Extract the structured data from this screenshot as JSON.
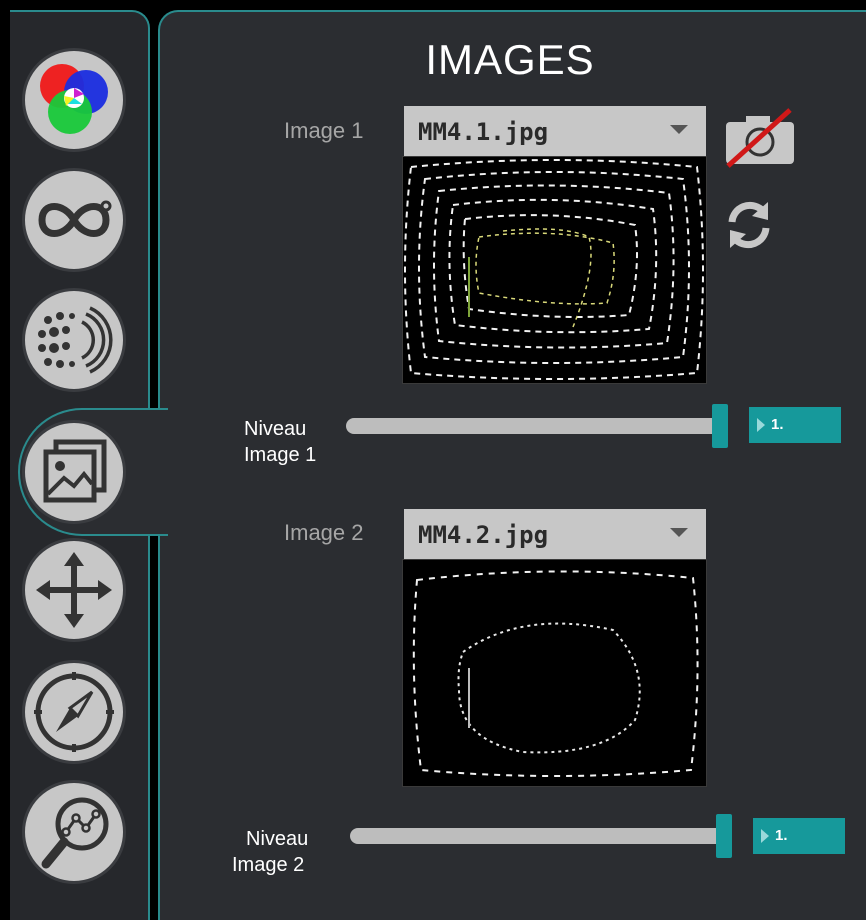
{
  "header": {
    "title": "IMAGES"
  },
  "sidebar": {
    "items": [
      {
        "name": "color-tab",
        "icon": "rgb-circles-icon"
      },
      {
        "name": "infinity-tab",
        "icon": "infinity-icon"
      },
      {
        "name": "pattern-tab",
        "icon": "dots-arcs-icon"
      },
      {
        "name": "images-tab",
        "icon": "image-gallery-icon",
        "active": true
      },
      {
        "name": "move-tab",
        "icon": "move-arrows-icon"
      },
      {
        "name": "compass-tab",
        "icon": "compass-icon"
      },
      {
        "name": "analysis-tab",
        "icon": "magnifier-graph-icon"
      }
    ]
  },
  "image1": {
    "label": "Image 1",
    "file": "MM4.1.jpg",
    "level_label_line1": "Niveau",
    "level_label_line2": "Image 1",
    "level_value": "1.",
    "level_fraction": 1.0
  },
  "image2": {
    "label": "Image 2",
    "file": "MM4.2.jpg",
    "level_label_line1": "Niveau",
    "level_label_line2": "Image 2",
    "level_value": "1.",
    "level_fraction": 1.0
  },
  "colors": {
    "accent": "#16999b",
    "panel": "#2b2d31",
    "sidebar": "#26282c",
    "border": "#2a8b8d"
  }
}
